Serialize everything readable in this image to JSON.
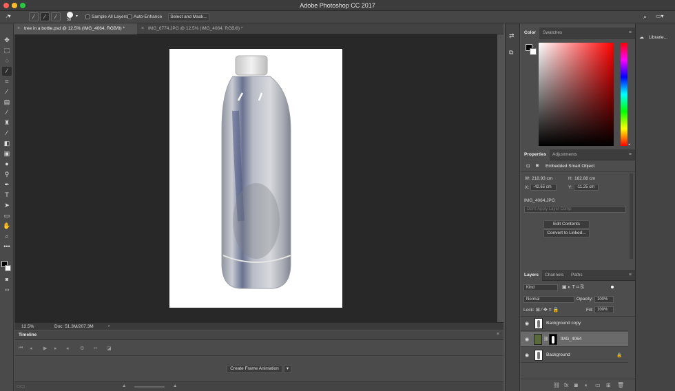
{
  "window": {
    "title": "Adobe Photoshop CC 2017"
  },
  "options_bar": {
    "brush_size": "58",
    "sample_all_layers": "Sample All Layers",
    "auto_enhance": "Auto-Enhance",
    "select_and_mask": "Select and Mask..."
  },
  "doc_tabs": [
    {
      "label": "tree in a bottle.psd @ 12.5% (IMG_4064, RGB/8) *",
      "active": true
    },
    {
      "label": "IMG_6774.JPG @ 12.5% (IMG_4064, RGB/8) *",
      "active": false
    }
  ],
  "status": {
    "zoom": "12.5%",
    "doc": "Doc: 51.3M/207.3M"
  },
  "timeline": {
    "label": "Timeline",
    "create_button": "Create Frame Animation"
  },
  "color_panel": {
    "tabs": [
      "Color",
      "Swatches"
    ]
  },
  "properties_panel": {
    "tabs": [
      "Properties",
      "Adjustments"
    ],
    "object_type": "Embedded Smart Object",
    "w_label": "W:",
    "w_value": "218.93 cm",
    "h_label": "H:",
    "h_value": "182.88 cm",
    "x_label": "X:",
    "x_value": "-42.65 cm",
    "y_label": "Y:",
    "y_value": "-11.25 cm",
    "source_file": "IMG_4064.JPG",
    "layer_comp": "Don't Apply Layer Comp",
    "edit_contents": "Edit Contents",
    "convert_linked": "Convert to Linked..."
  },
  "layers_panel": {
    "tabs": [
      "Layers",
      "Channels",
      "Paths"
    ],
    "kind": "Kind",
    "blend_mode": "Normal",
    "opacity_label": "Opacity:",
    "opacity_value": "100%",
    "lock_label": "Lock:",
    "fill_label": "Fill:",
    "fill_value": "100%",
    "layers": [
      {
        "name": "Background copy",
        "selected": false
      },
      {
        "name": "IMG_4064",
        "selected": true
      },
      {
        "name": "Background",
        "selected": false
      }
    ]
  },
  "libraries": {
    "label": "Librarie..."
  }
}
